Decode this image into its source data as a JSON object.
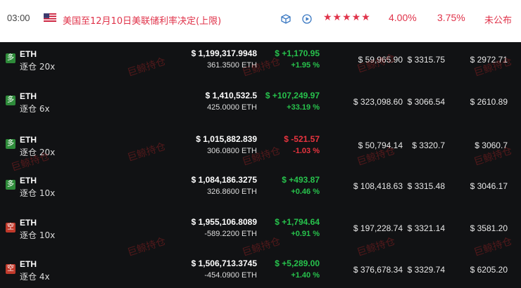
{
  "event": {
    "time": "03:00",
    "title": "美国至12月10日美联储利率决定(上限)",
    "stars": "★★★★★",
    "actual": "4.00%",
    "forecast": "3.75%",
    "previous": "未公布",
    "flag_icon": "us-flag-icon",
    "accent": "#e0334a"
  },
  "watermark": "巨鲸持仓",
  "positions": [
    {
      "side": "多",
      "side_type": "long",
      "symbol": "ETH",
      "leverage": "逐仓 20x",
      "value": "$ 1,199,317.9948",
      "qty": "361.3500 ETH",
      "pnl": "$ +1,170.95",
      "pnl_pct": "+1.95 %",
      "pnl_dir": "green",
      "margin": "$ 59,965.90",
      "entry": "$ 3315.75",
      "liq": "$ 2972.71"
    },
    {
      "side": "多",
      "side_type": "long",
      "symbol": "ETH",
      "leverage": "逐仓 6x",
      "value": "$ 1,410,532.5",
      "qty": "425.0000 ETH",
      "pnl": "$ +107,249.97",
      "pnl_pct": "+33.19 %",
      "pnl_dir": "green",
      "margin": "$ 323,098.60",
      "entry": "$ 3066.54",
      "liq": "$ 2610.89"
    },
    {
      "side": "多",
      "side_type": "long",
      "symbol": "ETH",
      "leverage": "逐仓 20x",
      "value": "$ 1,015,882.839",
      "qty": "306.0800 ETH",
      "pnl": "$ -521.57",
      "pnl_pct": "-1.03 %",
      "pnl_dir": "red",
      "margin": "$ 50,794.14",
      "entry": "$ 3320.7",
      "liq": "$ 3060.7"
    },
    {
      "side": "多",
      "side_type": "long",
      "symbol": "ETH",
      "leverage": "逐仓 10x",
      "value": "$ 1,084,186.3275",
      "qty": "326.8600 ETH",
      "pnl": "$ +493.87",
      "pnl_pct": "+0.46 %",
      "pnl_dir": "green",
      "margin": "$ 108,418.63",
      "entry": "$ 3315.48",
      "liq": "$ 3046.17"
    },
    {
      "side": "空",
      "side_type": "short",
      "symbol": "ETH",
      "leverage": "逐仓 10x",
      "value": "$ 1,955,106.8089",
      "qty": "-589.2200 ETH",
      "pnl": "$ +1,794.64",
      "pnl_pct": "+0.91 %",
      "pnl_dir": "green",
      "margin": "$ 197,228.74",
      "entry": "$ 3321.14",
      "liq": "$ 3581.20"
    },
    {
      "side": "空",
      "side_type": "short",
      "symbol": "ETH",
      "leverage": "逐仓 4x",
      "value": "$ 1,506,713.3745",
      "qty": "-454.0900 ETH",
      "pnl": "$ +5,289.00",
      "pnl_pct": "+1.40 %",
      "pnl_dir": "green",
      "margin": "$ 376,678.34",
      "entry": "$ 3329.74",
      "liq": "$ 6205.20"
    }
  ]
}
